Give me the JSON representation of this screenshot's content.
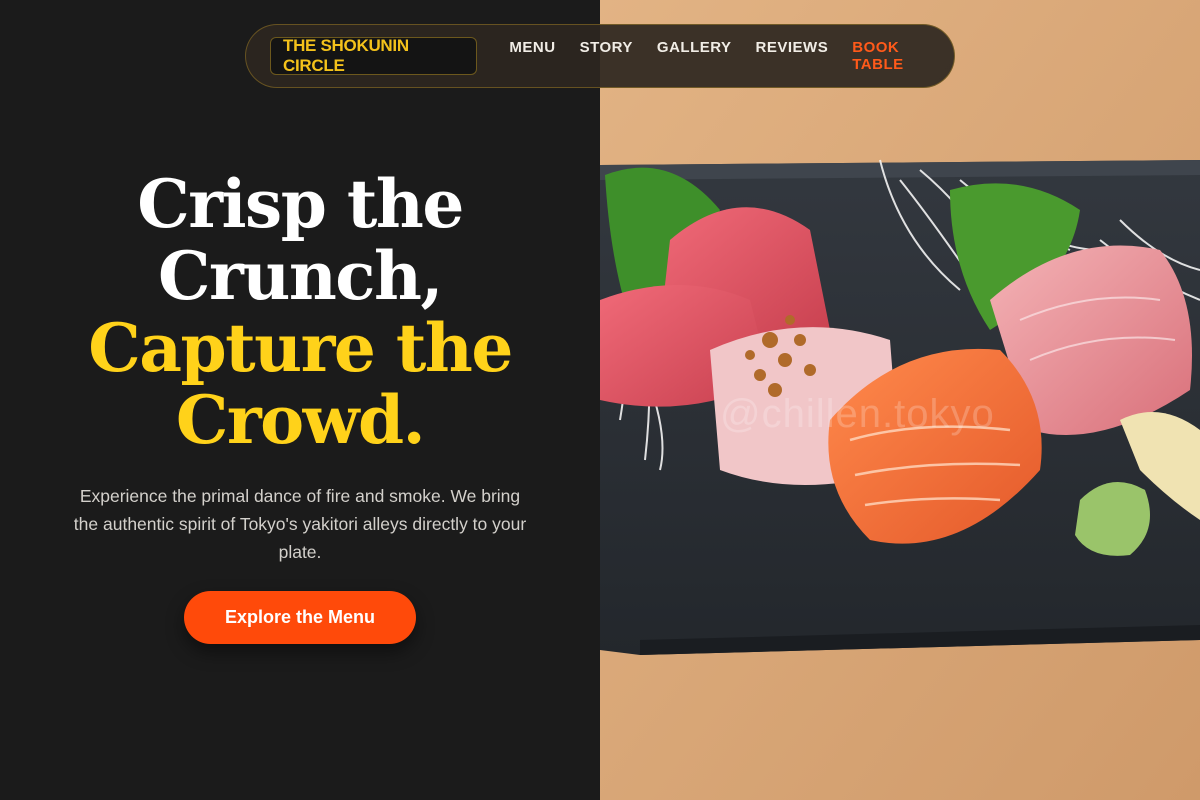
{
  "nav": {
    "brand": "THE SHOKUNIN CIRCLE",
    "links": [
      {
        "label": "MENU"
      },
      {
        "label": "STORY"
      },
      {
        "label": "GALLERY"
      },
      {
        "label": "REVIEWS"
      },
      {
        "label": "BOOK TABLE"
      }
    ]
  },
  "hero": {
    "headline_line1": "Crisp the",
    "headline_line2": "Crunch,",
    "headline_line3": "Capture the",
    "headline_line4": "Crowd.",
    "description": "Experience the primal dance of fire and smoke. We bring the authentic spirit of Tokyo's yakitori alleys directly to your plate.",
    "cta_label": "Explore the Menu"
  },
  "photo": {
    "watermark": "@chillen.tokyo"
  },
  "colors": {
    "background": "#1b1b1b",
    "accent_yellow": "#ffd21a",
    "accent_orange": "#ff4a0a"
  }
}
